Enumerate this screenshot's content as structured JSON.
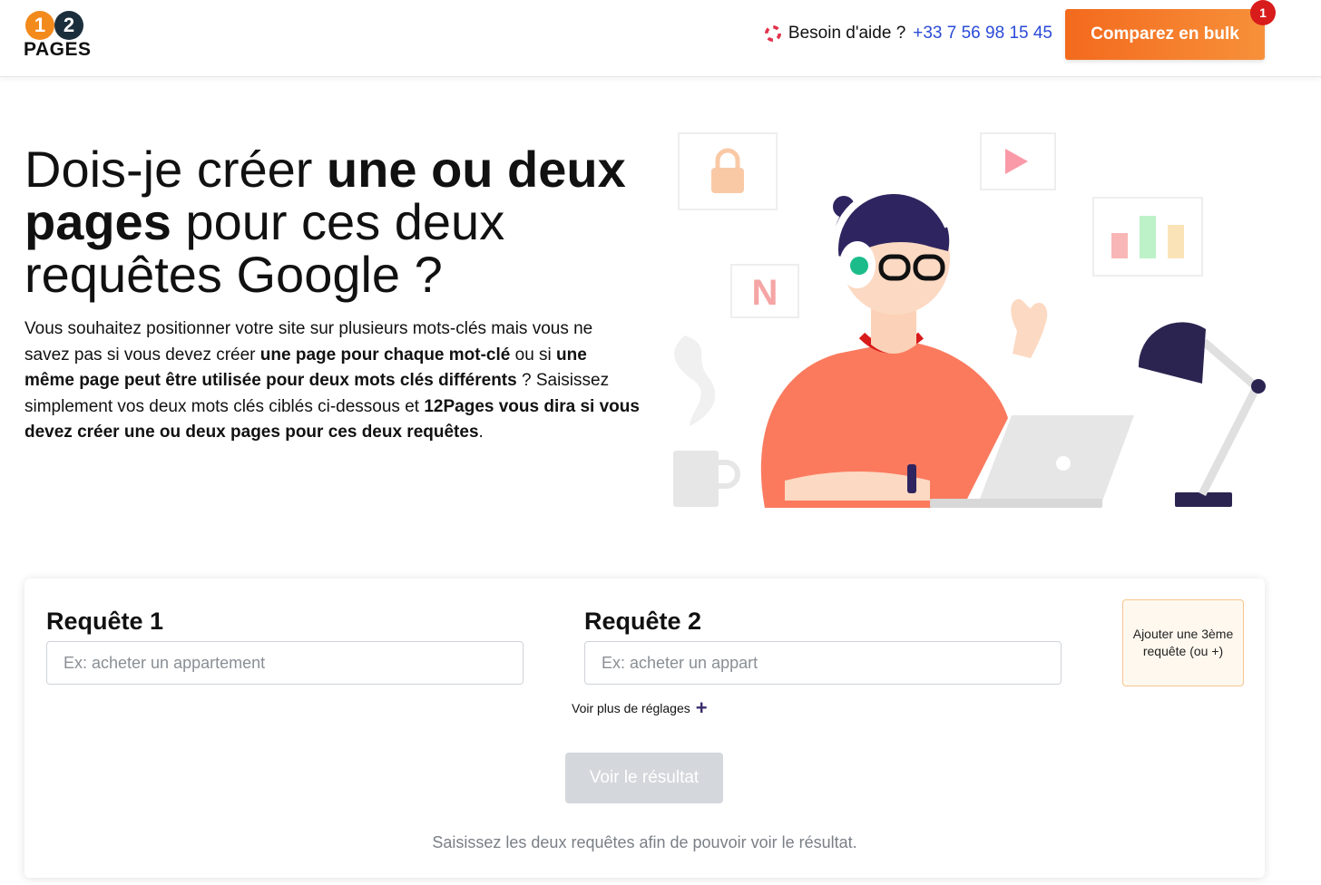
{
  "header": {
    "logo": {
      "digit1": "1",
      "digit2": "2",
      "word": "PAGES"
    },
    "help_text": "Besoin d'aide ?",
    "phone": "+33 7 56 98 15 45",
    "bulk_button": "Comparez en bulk",
    "notification_count": "1"
  },
  "hero": {
    "title_part1": "Dois-je créer ",
    "title_bold1": "une ou deux pages",
    "title_part2": " pour ces deux requêtes Google ?",
    "desc": [
      "Vous souhaitez positionner votre site sur plusieurs mots-clés mais vous ne savez pas si vous devez créer ",
      "une page pour chaque mot-clé",
      " ou si ",
      "une même page peut être utilisée pour deux mots clés différents",
      " ? Saisissez simplement vos deux mots clés ciblés ci-dessous et ",
      "12Pages vous dira si vous devez créer une ou deux pages pour ces deux requêtes",
      "."
    ],
    "illustration_icons": {
      "letter": "N"
    }
  },
  "form": {
    "query1_label": "Requête 1",
    "query1_placeholder": "Ex: acheter un appartement",
    "query1_value": "",
    "query2_label": "Requête 2",
    "query2_placeholder": "Ex: acheter un appart",
    "query2_value": "",
    "add_query_button": "Ajouter une 3ème requête (ou +)",
    "more_settings": "Voir plus de réglages",
    "more_settings_icon": "+",
    "result_button": "Voir le résultat",
    "hint": "Saisissez les deux requêtes afin de pouvoir voir le résultat."
  },
  "colors": {
    "brand_orange": "#f36a1d",
    "phone_blue": "#2a4bd7",
    "badge_red": "#d81b1b",
    "disabled_gray": "#d4d7dc"
  }
}
